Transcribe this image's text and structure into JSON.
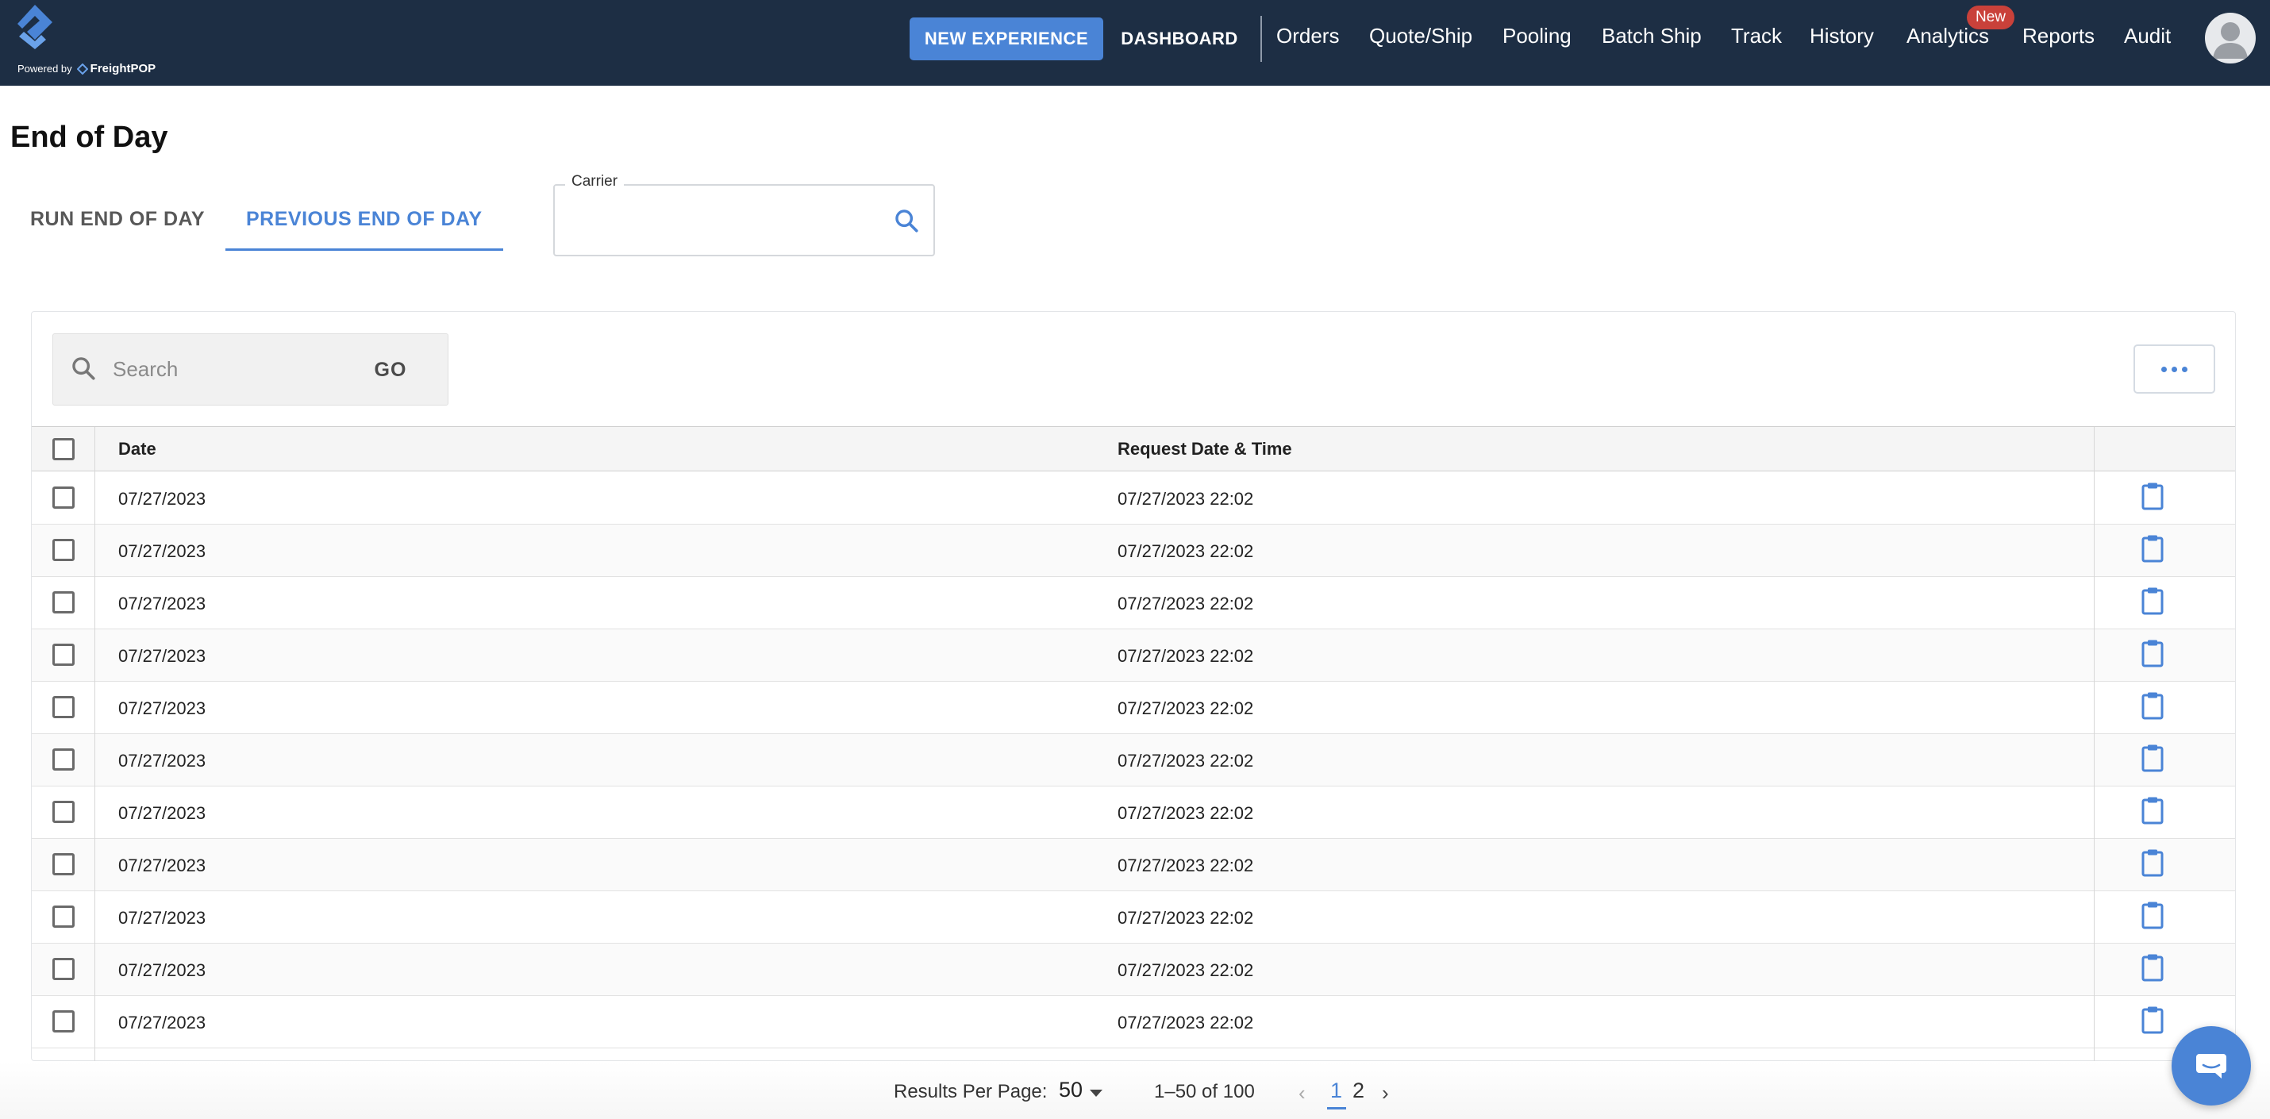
{
  "nav": {
    "powered_by": "Powered by",
    "brand": "FreightPOP",
    "new_experience": "NEW EXPERIENCE",
    "dashboard": "DASHBOARD",
    "items": [
      "Orders",
      "Quote/Ship",
      "Pooling",
      "Batch Ship",
      "Track",
      "History",
      "Analytics",
      "Reports",
      "Audit"
    ],
    "new_badge": "New"
  },
  "page": {
    "title": "End of Day",
    "tabs": [
      "RUN END OF DAY",
      "PREVIOUS END OF DAY"
    ],
    "active_tab": "PREVIOUS END OF DAY",
    "carrier_label": "Carrier",
    "carrier_value": ""
  },
  "toolbar": {
    "search_placeholder": "Search",
    "go_label": "GO"
  },
  "table": {
    "columns": [
      "Date",
      "Request Date & Time"
    ],
    "rows": [
      {
        "date": "07/27/2023",
        "request": "07/27/2023 22:02"
      },
      {
        "date": "07/27/2023",
        "request": "07/27/2023 22:02"
      },
      {
        "date": "07/27/2023",
        "request": "07/27/2023 22:02"
      },
      {
        "date": "07/27/2023",
        "request": "07/27/2023 22:02"
      },
      {
        "date": "07/27/2023",
        "request": "07/27/2023 22:02"
      },
      {
        "date": "07/27/2023",
        "request": "07/27/2023 22:02"
      },
      {
        "date": "07/27/2023",
        "request": "07/27/2023 22:02"
      },
      {
        "date": "07/27/2023",
        "request": "07/27/2023 22:02"
      },
      {
        "date": "07/27/2023",
        "request": "07/27/2023 22:02"
      },
      {
        "date": "07/27/2023",
        "request": "07/27/2023 22:02"
      },
      {
        "date": "07/27/2023",
        "request": "07/27/2023 22:02"
      }
    ]
  },
  "pagination": {
    "results_per_page_label": "Results Per Page:",
    "results_per_page": "50",
    "range": "1–50 of 100",
    "pages": [
      "1",
      "2"
    ],
    "current_page": "1"
  },
  "colors": {
    "nav_bg": "#1d2e44",
    "accent": "#4a84d6",
    "badge": "#c9413a"
  }
}
